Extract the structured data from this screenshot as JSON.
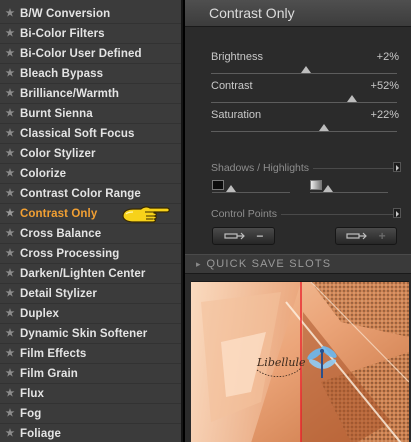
{
  "filters": [
    {
      "label": "B/W Conversion"
    },
    {
      "label": "Bi-Color Filters"
    },
    {
      "label": "Bi-Color User Defined"
    },
    {
      "label": "Bleach Bypass"
    },
    {
      "label": "Brilliance/Warmth"
    },
    {
      "label": "Burnt Sienna"
    },
    {
      "label": "Classical Soft Focus"
    },
    {
      "label": "Color Stylizer"
    },
    {
      "label": "Colorize"
    },
    {
      "label": "Contrast Color Range"
    },
    {
      "label": "Contrast Only"
    },
    {
      "label": "Cross Balance"
    },
    {
      "label": "Cross Processing"
    },
    {
      "label": "Darken/Lighten Center"
    },
    {
      "label": "Detail Stylizer"
    },
    {
      "label": "Duplex"
    },
    {
      "label": "Dynamic Skin Softener"
    },
    {
      "label": "Film Effects"
    },
    {
      "label": "Film Grain"
    },
    {
      "label": "Flux"
    },
    {
      "label": "Fog"
    },
    {
      "label": "Foliage"
    }
  ],
  "selected_filter": "Contrast Only",
  "panel": {
    "title": "Contrast Only",
    "params": [
      {
        "label": "Brightness",
        "value": "+2%",
        "level": 0.51
      },
      {
        "label": "Contrast",
        "value": "+52%",
        "level": 0.76
      },
      {
        "label": "Saturation",
        "value": "+22%",
        "level": 0.61
      }
    ],
    "shadows_highlights_label": "Shadows / Highlights",
    "control_points_label": "Control Points",
    "control_points_remove_glyph": "−",
    "control_points_add_glyph": "+"
  },
  "quick_save": {
    "label": "QUICK SAVE SLOTS"
  },
  "preview": {
    "watermark": "Libellule"
  },
  "colors": {
    "active_filter": "#f2a033",
    "list_bg": "#3b3b3b",
    "panel_bg": "#2b2b2b",
    "preview_red_line": "#e8202a"
  },
  "icons": {
    "list_bullet": "star-icon",
    "pointer": "pointing-hand-icon"
  }
}
